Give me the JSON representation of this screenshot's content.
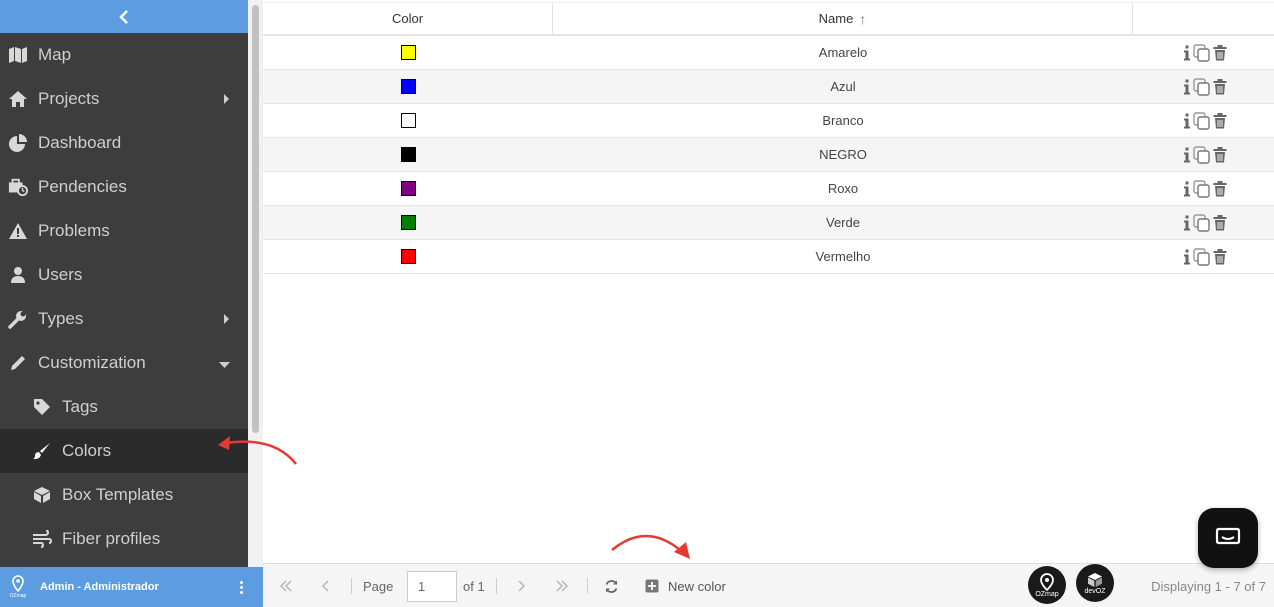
{
  "sidebar": {
    "items": [
      {
        "label": "Map",
        "icon": "map-icon"
      },
      {
        "label": "Projects",
        "icon": "home-icon"
      },
      {
        "label": "Dashboard",
        "icon": "pie-chart-icon"
      },
      {
        "label": "Pendencies",
        "icon": "briefcase-clock-icon"
      },
      {
        "label": "Problems",
        "icon": "warning-icon"
      },
      {
        "label": "Users",
        "icon": "user-icon"
      },
      {
        "label": "Types",
        "icon": "wrench-icon"
      },
      {
        "label": "Customization",
        "icon": "pencil-icon"
      },
      {
        "label": "Tags",
        "icon": "tag-icon"
      },
      {
        "label": "Colors",
        "icon": "brush-icon"
      },
      {
        "label": "Box Templates",
        "icon": "cube-icon"
      },
      {
        "label": "Fiber profiles",
        "icon": "wind-icon"
      }
    ],
    "active_item": "Colors"
  },
  "user": {
    "name": "Admin - Administrador",
    "logo_text": "OZmap"
  },
  "table": {
    "headers": {
      "color": "Color",
      "name": "Name",
      "sort_indicator": "↑"
    },
    "rows": [
      {
        "color": "#ffff00",
        "name": "Amarelo"
      },
      {
        "color": "#0000ff",
        "name": "Azul"
      },
      {
        "color": "#ffffff",
        "name": "Branco"
      },
      {
        "color": "#000000",
        "name": "NEGRO"
      },
      {
        "color": "#800080",
        "name": "Roxo"
      },
      {
        "color": "#008000",
        "name": "Verde"
      },
      {
        "color": "#ff0000",
        "name": "Vermelho"
      }
    ]
  },
  "footer": {
    "page_label": "Page",
    "page_value": "1",
    "of_label": "of 1",
    "new_label": "New color",
    "display_text": "Displaying 1 - 7 of 7",
    "badge1": "OZmap",
    "badge2": "devOZ"
  },
  "colors": {
    "accent": "#5b9de0",
    "sidebar": "#3d3d3d",
    "annotation": "#e53935"
  }
}
